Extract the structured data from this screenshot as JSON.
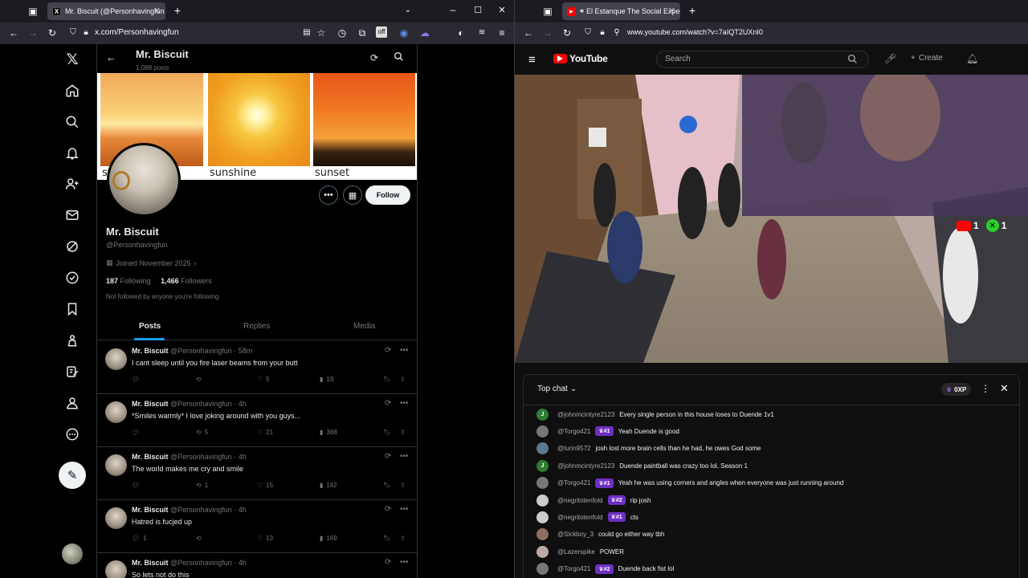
{
  "left_browser": {
    "tab_title": "Mr. Biscuit (@Personhavingfun",
    "url": "x.com/Personhavingfun"
  },
  "right_browser": {
    "tab_title": "El Estanque The Social Expe",
    "url": "www.youtube.com/watch?v=7aIQT2UXnI0"
  },
  "x": {
    "header_name": "Mr. Biscuit",
    "header_posts": "1,088 posts",
    "banner_captions": [
      "s",
      "sunshine",
      "sunset"
    ],
    "display_name": "Mr. Biscuit",
    "handle": "@Personhavingfun",
    "joined": "Joined November 2025",
    "following_count": "187",
    "following_label": "Following",
    "followers_count": "1,466",
    "followers_label": "Followers",
    "not_followed": "Not followed by anyone you're following",
    "follow_label": "Follow",
    "tabs": [
      "Posts",
      "Replies",
      "Media"
    ],
    "posts": [
      {
        "name": "Mr. Biscuit",
        "meta": "@Personhavingfun · 58m",
        "text": "I cant sleep until you fire laser beams from your butt",
        "replies": "",
        "reposts": "",
        "likes": "5",
        "views": "19"
      },
      {
        "name": "Mr. Biscuit",
        "meta": "@Personhavingfun · 4h",
        "text": "*Smiles warmly* I love joking around with you guys...",
        "replies": "",
        "reposts": "5",
        "likes": "21",
        "views": "368"
      },
      {
        "name": "Mr. Biscuit",
        "meta": "@Personhavingfun · 4h",
        "text": "The world makes me cry and smile",
        "replies": "",
        "reposts": "1",
        "likes": "15",
        "views": "162"
      },
      {
        "name": "Mr. Biscuit",
        "meta": "@Personhavingfun · 4h",
        "text": "Hatred is fucjed up",
        "replies": "1",
        "reposts": "",
        "likes": "13",
        "views": "169"
      },
      {
        "name": "Mr. Biscuit",
        "meta": "@Personhavingfun · 4h",
        "text": "So lets not do this",
        "replies": "",
        "reposts": "",
        "likes": "",
        "views": ""
      }
    ]
  },
  "youtube": {
    "logo_text": "YouTube",
    "search_placeholder": "Search",
    "create_label": "Create",
    "overlay_counts": [
      "1",
      "1"
    ],
    "chat_mode": "Top chat",
    "points_badge": "0XP",
    "messages": [
      {
        "author": "@johnmcintyre2123",
        "badge": "",
        "text": "Every single person in this house loses to Duende 1v1",
        "avatar_color": "#2e7d32",
        "initial": "J"
      },
      {
        "author": "@Torgo421",
        "badge": "#1",
        "text": "Yeah Duende is good",
        "avatar_color": "#777777",
        "initial": ""
      },
      {
        "author": "@turin9572",
        "badge": "",
        "text": "josh lost more brain cells than he had, he owes God some",
        "avatar_color": "#5c7890",
        "initial": ""
      },
      {
        "author": "@johnmcintyre2123",
        "badge": "",
        "text": "Duende paintball was crazy too lol. Season 1",
        "avatar_color": "#2e7d32",
        "initial": "J"
      },
      {
        "author": "@Torgo421",
        "badge": "#1",
        "text": "Yeah he was using corners and angles when everyone was just running around",
        "avatar_color": "#777777",
        "initial": ""
      },
      {
        "author": "@negritotenfold",
        "badge": "#2",
        "text": "rip josh",
        "avatar_color": "#cccccc",
        "initial": ""
      },
      {
        "author": "@negritotenfold",
        "badge": "#1",
        "text": "cts",
        "avatar_color": "#cccccc",
        "initial": ""
      },
      {
        "author": "@Sickboy_3",
        "badge": "",
        "text": "could go either way tbh",
        "avatar_color": "#8d6e63",
        "initial": ""
      },
      {
        "author": "@Lazerspike",
        "badge": "",
        "text": "POWER",
        "avatar_color": "#bcaaa4",
        "initial": ""
      },
      {
        "author": "@Torgo421",
        "badge": "#2",
        "text": "Duende back fist lol",
        "avatar_color": "#777777",
        "initial": ""
      }
    ]
  }
}
